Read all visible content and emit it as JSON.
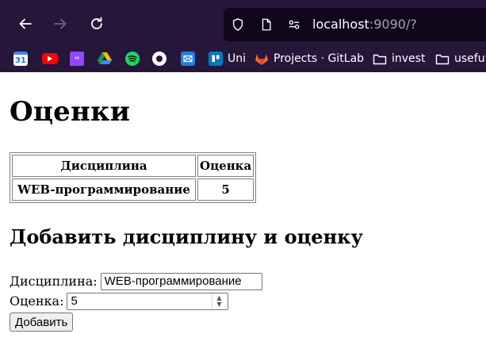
{
  "browser": {
    "url_host": "localhost",
    "url_rest": ":9090/?",
    "bookmarks": [
      {
        "icon": "google-calendar-icon",
        "label": "",
        "badge": "31",
        "color": "#4285f4"
      },
      {
        "icon": "youtube-icon",
        "label": "",
        "color": "#ff0000"
      },
      {
        "icon": "twitch-icon",
        "label": "",
        "color": "#9146ff"
      },
      {
        "icon": "google-drive-icon",
        "label": "",
        "color": "#fbbc04"
      },
      {
        "icon": "spotify-icon",
        "label": "",
        "color": "#1ed760"
      },
      {
        "icon": "github-icon",
        "label": "",
        "color": "#ffffff"
      },
      {
        "icon": "mail-icon",
        "label": "",
        "color": "#2a7de1"
      },
      {
        "icon": "trello-icon",
        "label": "Uni",
        "color": "#0079bf"
      },
      {
        "icon": "gitlab-icon",
        "label": "Projects · GitLab",
        "color": "#fc6d26"
      },
      {
        "icon": "folder-icon",
        "label": "invest",
        "color": "#ffffff"
      },
      {
        "icon": "folder-icon",
        "label": "useful",
        "color": "#ffffff"
      }
    ]
  },
  "page": {
    "title": "Оценки",
    "table": {
      "headers": [
        "Дисциплина",
        "Оценка"
      ],
      "rows": [
        [
          "WEB-программирование",
          "5"
        ]
      ]
    },
    "form_title": "Добавить дисциплину и оценку",
    "discipline_label": "Дисциплина:",
    "discipline_value": "WEB-программирование",
    "grade_label": "Оценка:",
    "grade_value": "5",
    "submit_label": "Добавить"
  }
}
